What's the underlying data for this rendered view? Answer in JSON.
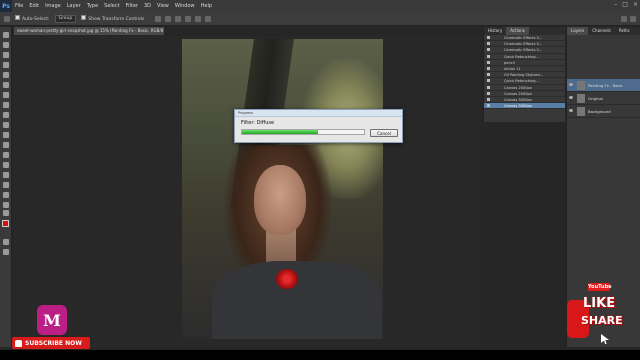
{
  "menubar": {
    "logo": "Ps",
    "items": [
      "File",
      "Edit",
      "Image",
      "Layer",
      "Type",
      "Select",
      "Filter",
      "3D",
      "View",
      "Window",
      "Help"
    ]
  },
  "options": {
    "auto_select_label": "Auto-Select:",
    "auto_select_value": "Group",
    "transform_label": "Show Transform Controls"
  },
  "document": {
    "tab_title": "sweet-woman-pretty-girl-snapshot.jpg @ 15% (Painting Fx - Basic, RGB/8) *"
  },
  "dialog": {
    "title": "Progress",
    "label": "Filter: Diffuse",
    "progress": 0.62,
    "cancel_label": "Cancel"
  },
  "actions_panel": {
    "tabs": [
      "History",
      "Actions"
    ],
    "rows": [
      {
        "label": "Cinematic Effects V...",
        "selected": false
      },
      {
        "label": "Cinematic Effects V...",
        "selected": false
      },
      {
        "label": "Cinematic Effects V...",
        "selected": false
      },
      {
        "label": "Quick Retouching...",
        "selected": false
      },
      {
        "label": "pencil",
        "selected": false
      },
      {
        "label": "Action 11",
        "selected": false
      },
      {
        "label": "Oil Painting Stylized...",
        "selected": false
      },
      {
        "label": "Quick Retouching...",
        "selected": false
      },
      {
        "label": "Canvas 2000px",
        "selected": false
      },
      {
        "label": "Canvas 2500px",
        "selected": false
      },
      {
        "label": "Canvas 3000px",
        "selected": false
      },
      {
        "label": "Canvas 3500px",
        "selected": true
      }
    ]
  },
  "layers_panel": {
    "tabs": [
      "Channels",
      "Paths"
    ],
    "header": "Layers",
    "layers": [
      {
        "name": "Painting Fx - Basic",
        "active": true
      },
      {
        "name": "Original",
        "active": false
      },
      {
        "name": "Background",
        "active": false
      }
    ]
  },
  "overlay": {
    "subscribe_label": "SUBSCRIBE NOW",
    "youtube_label": "YouTube",
    "like_label": "LIKE",
    "share_label": "SHARE"
  }
}
